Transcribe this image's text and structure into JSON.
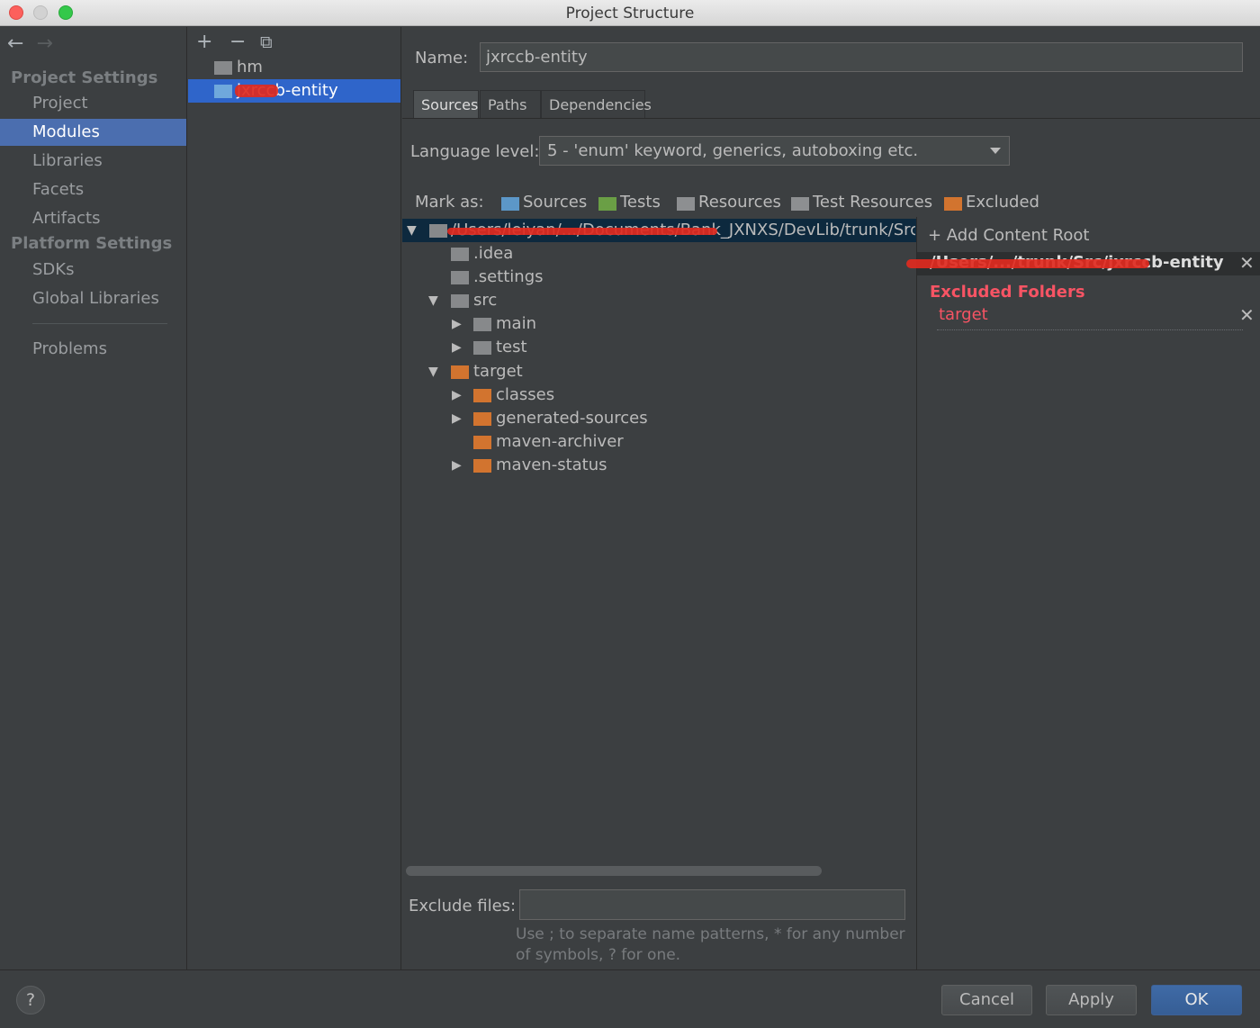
{
  "window": {
    "title": "Project Structure"
  },
  "sidebar": {
    "project_settings_header": "Project Settings",
    "platform_settings_header": "Platform Settings",
    "items": [
      {
        "label": "Project"
      },
      {
        "label": "Modules"
      },
      {
        "label": "Libraries"
      },
      {
        "label": "Facets"
      },
      {
        "label": "Artifacts"
      },
      {
        "label": "SDKs"
      },
      {
        "label": "Global Libraries"
      },
      {
        "label": "Problems"
      }
    ],
    "selected": "Modules"
  },
  "modules": {
    "items": [
      {
        "label": "hm"
      },
      {
        "label": "jxrccb-entity"
      }
    ],
    "selected": "jxrccb-entity"
  },
  "detail": {
    "name_label": "Name:",
    "name_value": "jxrccb-entity",
    "tabs": [
      {
        "label": "Sources"
      },
      {
        "label": "Paths"
      },
      {
        "label": "Dependencies"
      }
    ],
    "active_tab": "Sources",
    "language_level_label": "Language level:",
    "language_level_value": "5 - 'enum' keyword, generics, autoboxing etc.",
    "mark_as_label": "Mark as:",
    "mark_as": [
      {
        "label": "Sources",
        "color": "#6fa8dc"
      },
      {
        "label": "Tests",
        "color": "#6a9f45"
      },
      {
        "label": "Resources",
        "color": "#8d8f91"
      },
      {
        "label": "Test Resources",
        "color": "#8d8f91"
      },
      {
        "label": "Excluded",
        "color": "#d2742f"
      }
    ],
    "tree": [
      {
        "label": "/Users/leiyan/.../Documents/Bank_JXNXS/DevLib/trunk/Src",
        "expanded": true,
        "color": "#87898b"
      },
      {
        "label": ".idea",
        "color": "#87898b"
      },
      {
        "label": ".settings",
        "color": "#87898b"
      },
      {
        "label": "src",
        "expanded": true,
        "color": "#87898b"
      },
      {
        "label": "main",
        "expanded": false,
        "color": "#87898b"
      },
      {
        "label": "test",
        "expanded": false,
        "color": "#87898b"
      },
      {
        "label": "target",
        "expanded": true,
        "color": "#d2742f"
      },
      {
        "label": "classes",
        "expanded": false,
        "color": "#d2742f"
      },
      {
        "label": "generated-sources",
        "expanded": false,
        "color": "#d2742f"
      },
      {
        "label": "maven-archiver",
        "color": "#d2742f"
      },
      {
        "label": "maven-status",
        "expanded": false,
        "color": "#d2742f"
      }
    ],
    "content_root": {
      "add_label": "+ Add Content Root",
      "path": "/Users/.../trunk/Src/jxrccb-entity",
      "excluded_header": "Excluded Folders",
      "excluded_items": [
        "target"
      ]
    },
    "exclude_files_label": "Exclude files:",
    "exclude_files_value": "",
    "exclude_files_hint": "Use ; to separate name patterns, * for any number of symbols, ? for one."
  },
  "footer": {
    "help_label": "?",
    "cancel_label": "Cancel",
    "apply_label": "Apply",
    "ok_label": "OK"
  }
}
